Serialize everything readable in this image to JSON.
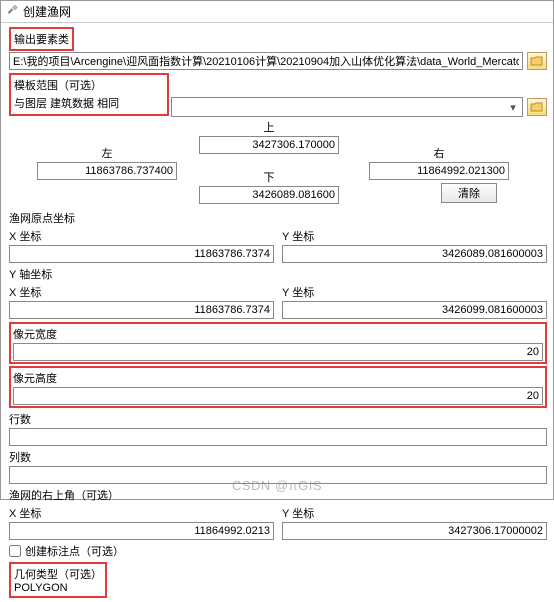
{
  "titlebar": {
    "title": "创建渔网"
  },
  "labels": {
    "output_fc": "输出要素类",
    "template_extent": "模板范围（可选）",
    "up": "上",
    "left": "左",
    "right": "右",
    "down": "下",
    "clear": "清除",
    "origin": "渔网原点坐标",
    "x_coord": "X 坐标",
    "y_coord": "Y 坐标",
    "y_axis": "Y 轴坐标",
    "cell_width": "像元宽度",
    "cell_height": "像元高度",
    "rows": "行数",
    "cols": "列数",
    "opp_corner": "渔网的右上角（可选）",
    "create_labels": "创建标注点（可选）",
    "geom_type": "几何类型（可选）"
  },
  "values": {
    "output_path": "E:\\我的项目\\Arcengine\\迎风面指数计算\\20210106计算\\20210904加入山体优化算法\\data_World_Mercator.gdb\\渔",
    "template_extent": "与图层 建筑数据 相同",
    "extent": {
      "up": "3427306.170000",
      "left": "11863786.737400",
      "right": "11864992.021300",
      "down": "3426089.081600"
    },
    "origin": {
      "x": "11863786.7374",
      "y": "3426089.081600003"
    },
    "y_axis": {
      "x": "11863786.7374",
      "y": "3426099.081600003"
    },
    "cell_width": "20",
    "cell_height": "20",
    "rows": "",
    "cols": "",
    "opp_corner": {
      "x": "11864992.0213",
      "y": "3427306.17000002"
    },
    "geom_type": "POLYGON"
  },
  "watermark": "CSDN @πGIS"
}
